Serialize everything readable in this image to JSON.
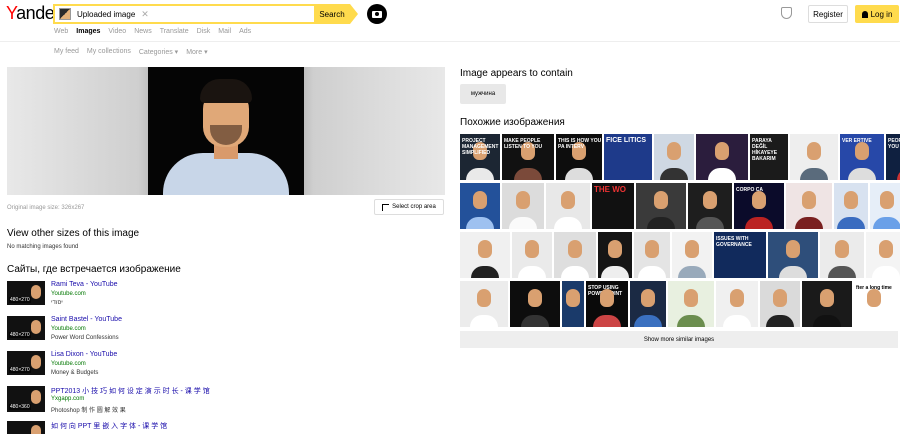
{
  "header": {
    "logo": {
      "y": "Y",
      "rest": "andex"
    },
    "search_value": "Uploaded image",
    "search_button": "Search",
    "register": "Register",
    "login": "Log in"
  },
  "tabs": [
    "Web",
    "Images",
    "Video",
    "News",
    "Translate",
    "Disk",
    "Mail",
    "Ads"
  ],
  "subtabs": [
    "My feed",
    "My collections",
    "Categories ▾",
    "More ▾"
  ],
  "main": {
    "original_size": "Original image size: 326x267",
    "crop_button": "Select crop area",
    "other_sizes_title": "View other sizes of this image",
    "no_matching": "No matching images found",
    "sites_title": "Сайты, где встречается изображение",
    "sites": [
      {
        "title": "Rami Teva - YouTube",
        "url": "Youtube.com",
        "desc": "יסודי",
        "res": "480×270"
      },
      {
        "title": "Saint Bastel - YouTube",
        "url": "Youtube.com",
        "desc": "Power Word Confessions",
        "res": "480×270"
      },
      {
        "title": "Lisa Dixon - YouTube",
        "url": "Youtube.com",
        "desc": "Money & Budgets",
        "res": "480×270"
      },
      {
        "title": "PPT2013 小 技 巧 如 何 设 定 演 示 时 长 - 课 学 馆",
        "url": "Yxgapp.com",
        "desc": "Photoshop 制 作 圆 解 效 果",
        "res": "480×360"
      },
      {
        "title": "如 何 向 PPT 里 嵌 入 字 体 - 课 学 馆",
        "url": "",
        "desc": "",
        "res": ""
      }
    ]
  },
  "right": {
    "contains_title": "Image appears to contain",
    "tag": "мужчина",
    "similar_title": "Похожие изображения",
    "more_button": "Show more similar images",
    "captions": {
      "r0c0": "PROJECT MANAGEMENT SIMPLIFIED",
      "r0c1": "MAKE PEOPLE LISTEN TO YOU",
      "r0c2": "THIS IS HOW YOU PA INTERV",
      "r0c3": "FICE LITICS",
      "r0c6": "PARAYA DEĞİL HİKAYEYE BAKARIM",
      "r0c8": "VER ERTIVE",
      "r0c9": "PEOPLE LISTEN TO YOU",
      "r1c2": "THE WO",
      "r1c5": "CORPO CA",
      "r2c6": "ISSUES WITH GOVERNANCE",
      "r3c3": "STOP USING POWERPOINT",
      "r3c9": "fter a long time"
    }
  }
}
